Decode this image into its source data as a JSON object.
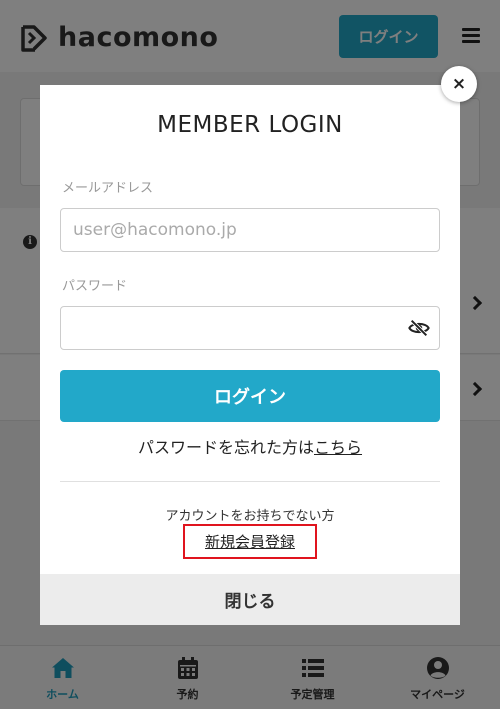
{
  "header": {
    "logo_text": "hacomono",
    "login_label": "ログイン"
  },
  "modal": {
    "title": "MEMBER LOGIN",
    "email_label": "メールアドレス",
    "email_placeholder": "user@hacomono.jp",
    "email_value": "",
    "password_label": "パスワード",
    "password_value": "",
    "login_button": "ログイン",
    "forgot_text": "パスワードを忘れた方は",
    "forgot_link": "こちら",
    "no_account_text": "アカウントをお持ちでない方",
    "register_link": "新規会員登録",
    "close_label": "閉じる",
    "close_glyph": "×"
  },
  "tabbar": {
    "items": [
      {
        "label": "ホーム",
        "icon": "home-icon",
        "active": true
      },
      {
        "label": "予約",
        "icon": "calendar-icon",
        "active": false
      },
      {
        "label": "予定管理",
        "icon": "list-icon",
        "active": false
      },
      {
        "label": "マイページ",
        "icon": "user-icon",
        "active": false
      }
    ]
  },
  "colors": {
    "accent": "#22a8c9",
    "highlight_border": "#e0141e",
    "overlay": "rgba(0,0,0,0.5)"
  }
}
